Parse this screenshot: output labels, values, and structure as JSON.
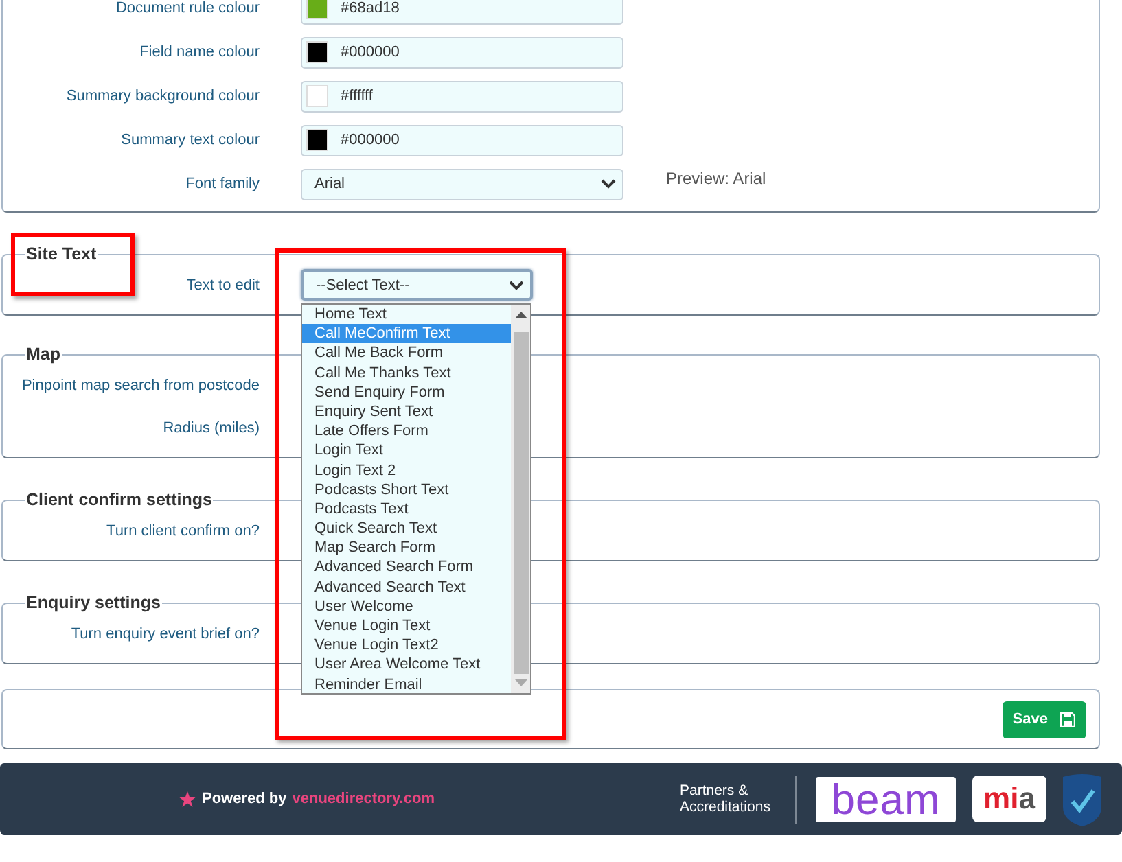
{
  "colour_settings": {
    "rows": [
      {
        "kind": "colour",
        "label": "Document rule colour",
        "value": "#68ad18",
        "color": "#68ad18"
      },
      {
        "kind": "colour",
        "label": "Field name colour",
        "value": "#000000",
        "color": "#000000"
      },
      {
        "kind": "colour",
        "label": "Summary background colour",
        "value": "#ffffff",
        "color": "#ffffff"
      },
      {
        "kind": "colour",
        "label": "Summary text colour",
        "value": "#000000",
        "color": "#000000"
      },
      {
        "kind": "select",
        "label": "Font family",
        "value": "Arial",
        "preview": "Preview: Arial"
      }
    ]
  },
  "sections": [
    {
      "legend": "Site Text",
      "highlighted": true,
      "fields": [
        {
          "kind": "select",
          "label": "Text to edit",
          "value": "--Select Text--",
          "expanded": true,
          "options": [
            {
              "label": "Home Text",
              "selected": false
            },
            {
              "label": "Call MeConfirm Text",
              "selected": true
            },
            {
              "label": "Call Me Back Form",
              "selected": false
            },
            {
              "label": "Call Me Thanks Text",
              "selected": false
            },
            {
              "label": "Send Enquiry Form",
              "selected": false
            },
            {
              "label": "Enquiry Sent Text",
              "selected": false
            },
            {
              "label": "Late Offers Form",
              "selected": false
            },
            {
              "label": "Login Text",
              "selected": false
            },
            {
              "label": "Login Text 2",
              "selected": false
            },
            {
              "label": "Podcasts Short Text",
              "selected": false
            },
            {
              "label": "Podcasts Text",
              "selected": false
            },
            {
              "label": "Quick Search Text",
              "selected": false
            },
            {
              "label": "Map Search Form",
              "selected": false
            },
            {
              "label": "Advanced Search Form",
              "selected": false
            },
            {
              "label": "Advanced Search Text",
              "selected": false
            },
            {
              "label": "User Welcome",
              "selected": false
            },
            {
              "label": "Venue Login Text",
              "selected": false
            },
            {
              "label": "Venue Login Text2",
              "selected": false
            },
            {
              "label": "User Area Welcome Text",
              "selected": false
            },
            {
              "label": "Reminder Email",
              "selected": false
            }
          ]
        }
      ]
    },
    {
      "legend": "Map",
      "highlighted": false,
      "fields": [
        {
          "kind": "label",
          "label": "Pinpoint map search from postcode"
        },
        {
          "kind": "label",
          "label": "Radius (miles)"
        }
      ]
    },
    {
      "legend": "Client confirm settings",
      "highlighted": false,
      "fields": [
        {
          "kind": "label",
          "label": "Turn client confirm on?"
        }
      ]
    },
    {
      "legend": "Enquiry settings",
      "highlighted": false,
      "fields": [
        {
          "kind": "label",
          "label": "Turn enquiry event brief on?"
        }
      ]
    }
  ],
  "save_button": "Save",
  "footer": {
    "powered_by": "Powered by",
    "brand": "venuedirectory.com",
    "partners": "Partners & Accreditations",
    "logos": [
      {
        "kind": "beam",
        "text": "beam"
      },
      {
        "kind": "mia",
        "text": "mia"
      },
      {
        "kind": "cyber"
      }
    ]
  }
}
